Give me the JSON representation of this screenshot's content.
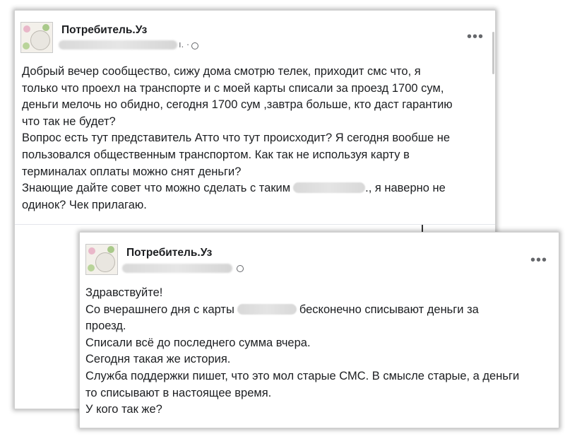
{
  "post1": {
    "page_name": "Потребитель.Уз",
    "meta_suffix": "ı. ·",
    "icons": {
      "avatar": "page-avatar",
      "privacy": "globe-icon",
      "more": "more-options-icon"
    },
    "lines": [
      "Добрый вечер сообщество, сижу дома смотрю телек, приходит смс что, я",
      "только что проехл на транспорте и с моей карты списали за проезд 1700 сум,",
      "деньги мелочь но обидно, сегодня 1700 сум ,завтра больше, кто даст гарантию",
      "что так не будет?",
      "Вопрос есть тут представитель Атто что тут происходит? Я сегодня вообше не",
      "пользовался общественным транспортом. Как так не используя карту в",
      "терминалах оплаты можно снят деньги?"
    ],
    "line_with_blur_start": "Знающие дайте совет что можно сделать с таким",
    "line_with_blur_end": "., я наверно не",
    "last_line": "одинок? Чек прилагаю."
  },
  "post2": {
    "page_name": "Потребитель.Уз",
    "icons": {
      "avatar": "page-avatar",
      "privacy": "globe-icon",
      "more": "more-options-icon"
    },
    "greeting": "Здравствуйте!",
    "line2_start": "Со вчерашнего дня с карты",
    "line2_end": "бесконечно списывают деньги за",
    "lines": [
      "проезд.",
      "Списали всё до последнего сумма вчера.",
      "Сегодня такая же история.",
      "Служба поддержки пишет, что это мол старые СМС. В смысле старые, а деньги",
      "то списывают в настоящее время.",
      "У кого так же?"
    ]
  },
  "colors": {
    "text": "#1c1e21",
    "meta": "#65676b",
    "card_bg": "#ffffff"
  }
}
